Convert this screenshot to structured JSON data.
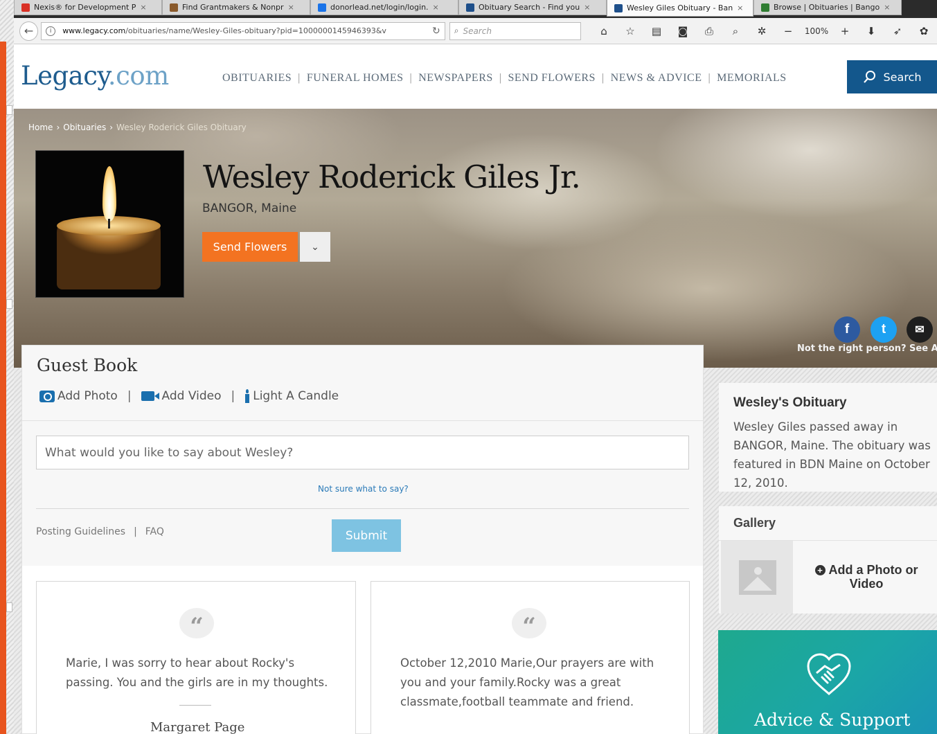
{
  "browser": {
    "tabs": [
      {
        "title": "Nexis® for Development P",
        "icon_color": "#d93025",
        "active": false
      },
      {
        "title": "Find Grantmakers & Nonpr",
        "icon_color": "#8a5a2b",
        "active": false
      },
      {
        "title": "donorlead.net/login/login.",
        "icon_color": "#1a73e8",
        "active": false
      },
      {
        "title": "Obituary Search - Find you",
        "icon_color": "#1e4f8a",
        "active": false
      },
      {
        "title": "Wesley Giles Obituary - Ban",
        "icon_color": "#1e4f8a",
        "active": true
      },
      {
        "title": "Browse | Obituaries | Bango",
        "icon_color": "#2f7d32",
        "active": false
      }
    ],
    "tab_close_glyph": "×",
    "url_host": "www.legacy.com",
    "url_path": "/obituaries/name/Wesley-Giles-obituary?pid=1000000145946393&v",
    "search_placeholder": "Search",
    "zoom": "100%"
  },
  "site": {
    "logo_main": "Legacy",
    "logo_suffix": ".com",
    "nav": [
      "OBITUARIES",
      "FUNERAL HOMES",
      "NEWSPAPERS",
      "SEND FLOWERS",
      "NEWS & ADVICE",
      "MEMORIALS"
    ],
    "search_label": "Search",
    "brand_color": "#13578c"
  },
  "hero": {
    "breadcrumb": [
      "Home",
      "Obituaries",
      "Wesley Roderick Giles Obituary"
    ],
    "name": "Wesley Roderick Giles Jr.",
    "location": "BANGOR, Maine",
    "send_flowers_label": "Send Flowers",
    "accent_color": "#f37321",
    "not_right_person": "Not the right person? See All",
    "social": {
      "facebook": "f",
      "twitter": "t",
      "email": "✉"
    }
  },
  "guestbook": {
    "title": "Guest Book",
    "actions": [
      "Add Photo",
      "Add Video",
      "Light A Candle"
    ],
    "input_placeholder": "What would you like to say about Wesley?",
    "not_sure": "Not sure what to say?",
    "links": [
      "Posting Guidelines",
      "FAQ"
    ],
    "link_sep": "|",
    "submit_label": "Submit",
    "entries": [
      {
        "text": "Marie, I was sorry to hear about Rocky's passing. You and the girls are in my thoughts.",
        "author": "Margaret Page"
      },
      {
        "text": "October 12,2010 Marie,Our prayers are with you and your family.Rocky was a great classmate,football teammate and friend.",
        "author": ""
      }
    ]
  },
  "sidebar": {
    "obituary_title": "Wesley's Obituary",
    "obituary_text": "Wesley Giles passed away in BANGOR, Maine. The obituary was featured in BDN Maine on October 12, 2010.",
    "gallery_title": "Gallery",
    "gallery_add": "Add a Photo or Video",
    "advice_title": "Advice & Support"
  }
}
